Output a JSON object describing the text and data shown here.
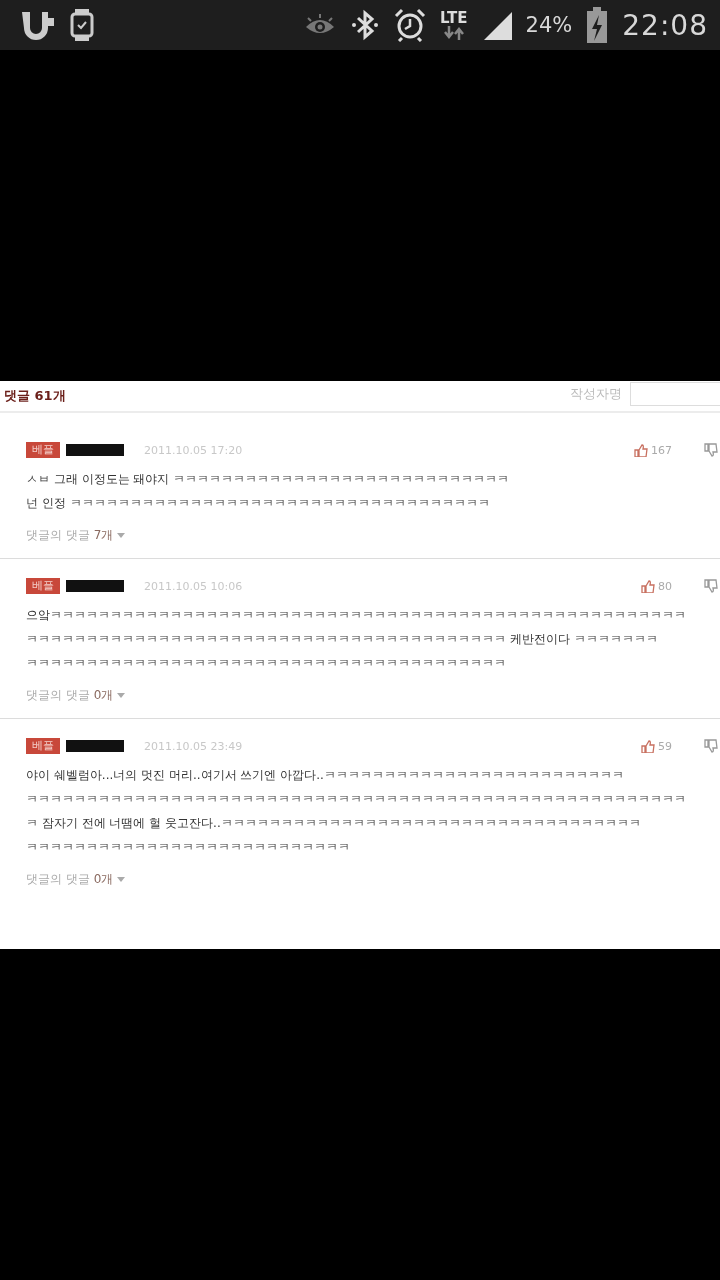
{
  "status_bar": {
    "network": "LTE",
    "battery": "24%",
    "time": "22:08"
  },
  "comments_section": {
    "heading": "댓글 61개",
    "author_field": {
      "placeholder": "작성자명"
    },
    "comments": [
      {
        "badge": "베플",
        "date": "2011.10.05 17:20",
        "likes": "167",
        "lines": [
          "ㅅㅂ 그래 이정도는 돼야지 ㅋㅋㅋㅋㅋㅋㅋㅋㅋㅋㅋㅋㅋㅋㅋㅋㅋㅋㅋㅋㅋㅋㅋㅋㅋㅋㅋㅋ",
          "넌 인정 ㅋㅋㅋㅋㅋㅋㅋㅋㅋㅋㅋㅋㅋㅋㅋㅋㅋㅋㅋㅋㅋㅋㅋㅋㅋㅋㅋㅋㅋㅋㅋㅋㅋㅋㅋ"
        ],
        "replies_label": "댓글의 댓글",
        "replies_count": "7개"
      },
      {
        "badge": "베플",
        "date": "2011.10.05 10:06",
        "likes": "80",
        "lines": [
          "으앜ㅋㅋㅋㅋㅋㅋㅋㅋㅋㅋㅋㅋㅋㅋㅋㅋㅋㅋㅋㅋㅋㅋㅋㅋㅋㅋㅋㅋㅋㅋㅋㅋㅋㅋㅋㅋㅋㅋㅋㅋㅋㅋㅋㅋㅋㅋㅋㅋㅋㅋㅋㅋㅋ",
          "ㅋㅋㅋㅋㅋㅋㅋㅋㅋㅋㅋㅋㅋㅋㅋㅋㅋㅋㅋㅋㅋㅋㅋㅋㅋㅋㅋㅋㅋㅋㅋㅋㅋㅋㅋㅋㅋㅋㅋㅋ 케반전이다 ㅋㅋㅋㅋㅋㅋㅋ",
          "ㅋㅋㅋㅋㅋㅋㅋㅋㅋㅋㅋㅋㅋㅋㅋㅋㅋㅋㅋㅋㅋㅋㅋㅋㅋㅋㅋㅋㅋㅋㅋㅋㅋㅋㅋㅋㅋㅋㅋㅋ"
        ],
        "replies_label": "댓글의 댓글",
        "replies_count": "0개"
      },
      {
        "badge": "베플",
        "date": "2011.10.05 23:49",
        "likes": "59",
        "lines": [
          "야이 쉐벨럼아...너의 멋진 머리..여기서 쓰기엔 아깝다..ㅋㅋㅋㅋㅋㅋㅋㅋㅋㅋㅋㅋㅋㅋㅋㅋㅋㅋㅋㅋㅋㅋㅋㅋㅋ",
          "ㅋㅋㅋㅋㅋㅋㅋㅋㅋㅋㅋㅋㅋㅋㅋㅋㅋㅋㅋㅋㅋㅋㅋㅋㅋㅋㅋㅋㅋㅋㅋㅋㅋㅋㅋㅋㅋㅋㅋㅋㅋㅋㅋㅋㅋㅋㅋㅋㅋㅋㅋㅋㅋㅋㅋ",
          "ㅋ 잠자기 전에 너땜에 헐 웃고잔다..ㅋㅋㅋㅋㅋㅋㅋㅋㅋㅋㅋㅋㅋㅋㅋㅋㅋㅋㅋㅋㅋㅋㅋㅋㅋㅋㅋㅋㅋㅋㅋㅋㅋㅋㅋ",
          "ㅋㅋㅋㅋㅋㅋㅋㅋㅋㅋㅋㅋㅋㅋㅋㅋㅋㅋㅋㅋㅋㅋㅋㅋㅋㅋㅋ"
        ],
        "replies_label": "댓글의 댓글",
        "replies_count": "0개"
      }
    ]
  }
}
